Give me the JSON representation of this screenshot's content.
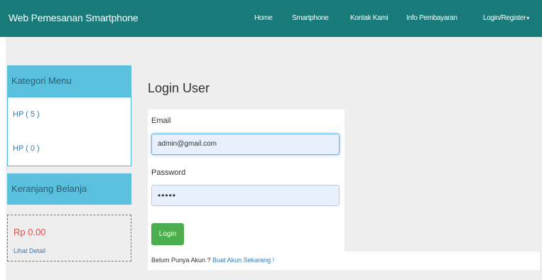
{
  "navbar": {
    "brand": "Web Pemesanan Smartphone",
    "items": [
      "Home",
      "Smartphone",
      "Kontak Kami",
      "Info Pembayaran",
      "Login/Register"
    ],
    "caret": "▾",
    "background": "#187b7a"
  },
  "sidebar": {
    "category_title": "Kategori Menu",
    "categories": [
      "HP ( 5 )",
      "HP ( 0 )"
    ],
    "cart_title": "Keranjang Belanja",
    "cart_total": "Rp 0.00",
    "cart_link": "Lihat Detail"
  },
  "login": {
    "title": "Login User",
    "email_label": "Email",
    "email_value": "admin@gmail.com",
    "password_label": "Password",
    "password_value": "•••••",
    "button": "Login",
    "register_prompt": "Belum Punya Akun ?",
    "register_link": "Buat Akun Sekarang !"
  },
  "colors": {
    "accent": "#5bc0de",
    "button": "#4cae4c",
    "price": "#d9534f",
    "link": "#337ab7"
  }
}
